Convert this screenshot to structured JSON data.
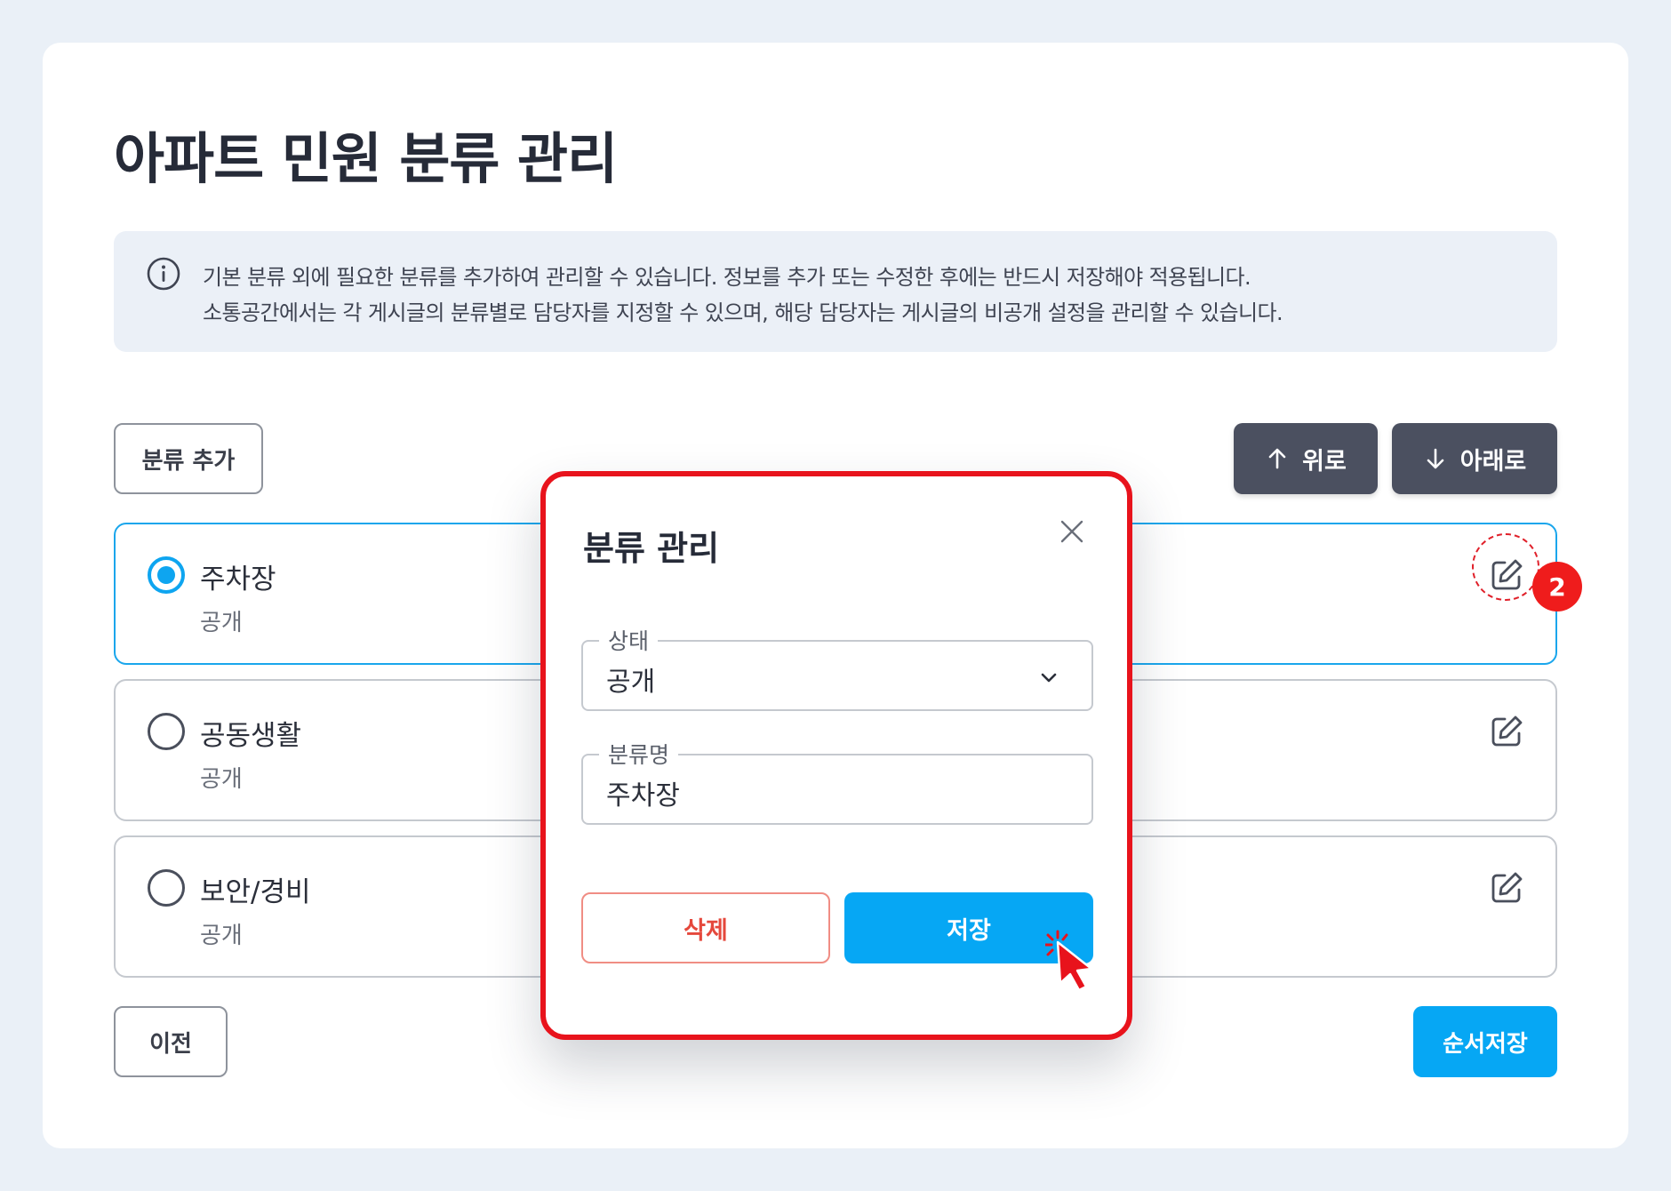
{
  "page": {
    "title": "아파트 민원 분류 관리",
    "info": {
      "line1": "기본 분류 외에 필요한 분류를 추가하여 관리할 수 있습니다. 정보를 추가 또는 수정한 후에는 반드시 저장해야 적용됩니다.",
      "line2": "소통공간에서는 각 게시글의 분류별로 담당자를 지정할 수 있으며, 해당 담당자는 게시글의 비공개 설정을 관리할 수 있습니다."
    }
  },
  "toolbar": {
    "add_label": "분류 추가",
    "up_label": "위로",
    "down_label": "아래로"
  },
  "categories": [
    {
      "name": "주차장",
      "status": "공개",
      "selected": true
    },
    {
      "name": "공동생활",
      "status": "공개",
      "selected": false
    },
    {
      "name": "보안/경비",
      "status": "공개",
      "selected": false
    }
  ],
  "footer": {
    "prev_label": "이전",
    "save_order_label": "순서저장"
  },
  "step_badge": "2",
  "modal": {
    "title": "분류 관리",
    "status_field": {
      "label": "상태",
      "value": "공개"
    },
    "name_field": {
      "label": "분류명",
      "value": "주차장"
    },
    "delete_label": "삭제",
    "save_label": "저장"
  },
  "colors": {
    "primary": "#06a7f4",
    "dark_button": "#4b5060",
    "highlight": "#e8131c",
    "danger": "#e5483c"
  }
}
